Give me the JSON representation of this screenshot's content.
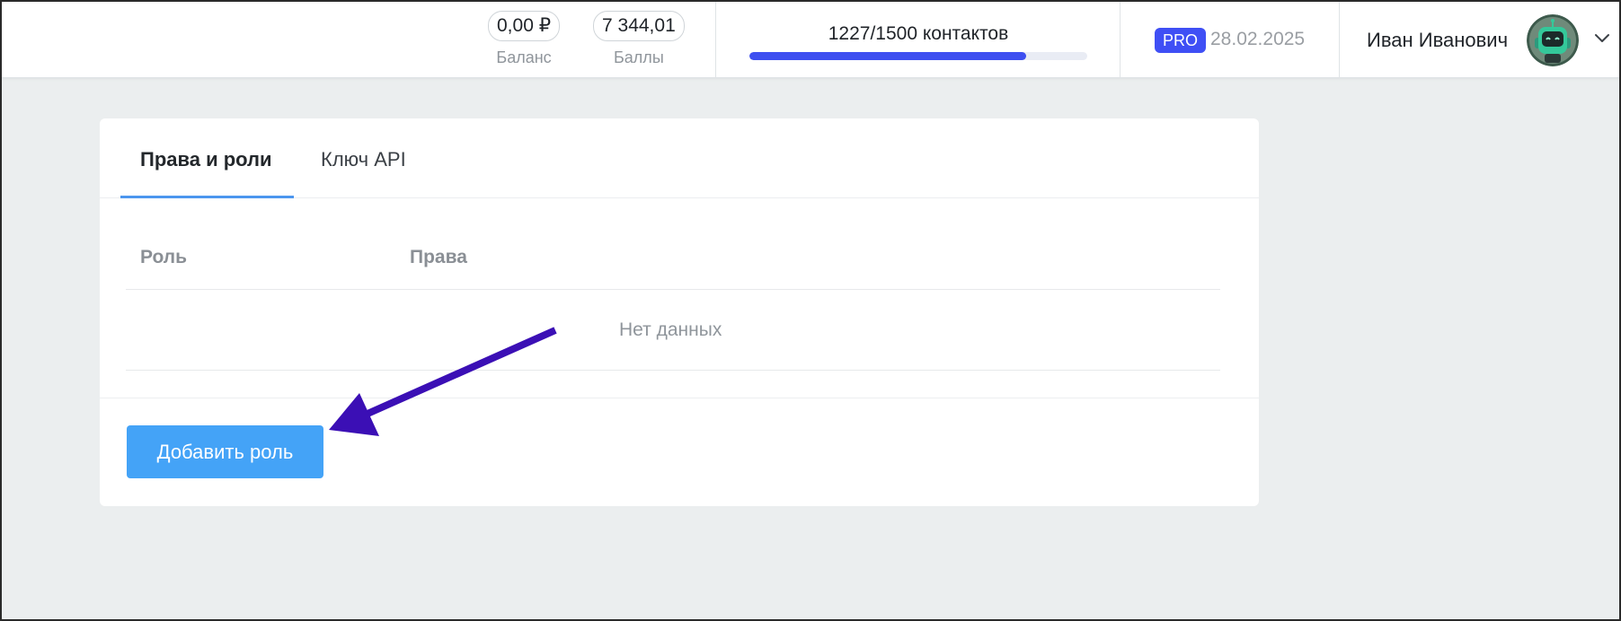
{
  "header": {
    "balance": {
      "value": "0,00 ₽",
      "label": "Баланс"
    },
    "points": {
      "value": "7 344,01",
      "label": "Баллы"
    },
    "contacts": {
      "text": "1227/1500 контактов",
      "used": 1227,
      "limit": 1500
    },
    "plan": {
      "badge": "PRO",
      "date": "28.02.2025"
    },
    "user": {
      "name": "Иван Иванович",
      "avatar_icon": "robot-avatar-icon",
      "menu_icon": "chevron-down-icon"
    }
  },
  "tabs": [
    {
      "label": "Права и роли",
      "active": true
    },
    {
      "label": "Ключ API",
      "active": false
    }
  ],
  "table": {
    "columns": [
      "Роль",
      "Права"
    ],
    "empty_text": "Нет данных"
  },
  "actions": {
    "add_role_label": "Добавить роль"
  },
  "colors": {
    "accent": "#3f4ff5",
    "button": "#44a3f7",
    "annotation_arrow": "#3b0fb5"
  }
}
